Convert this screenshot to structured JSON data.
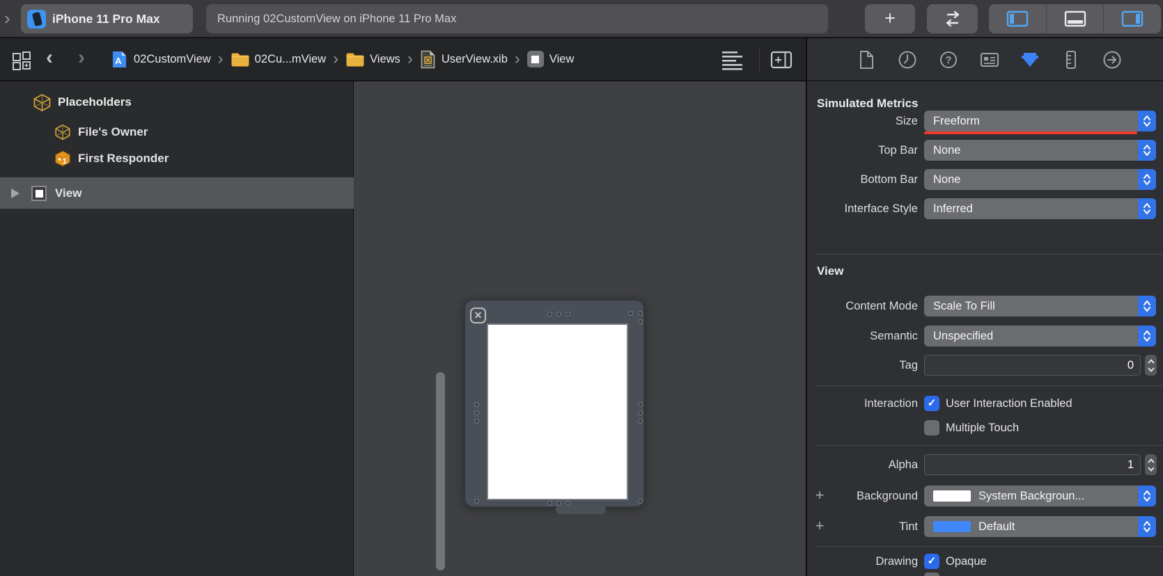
{
  "glyphs": {
    "plus": "+",
    "chevron_left": "‹",
    "chevron_right": "›",
    "breadcrumb_sep": "›",
    "check": "✓",
    "question": "?",
    "arrow_right": "→",
    "letter_a": "A",
    "one": "1",
    "x_close": "✕"
  },
  "toolbar": {
    "device_name": "iPhone 11 Pro Max",
    "status_text": "Running 02CustomView on iPhone 11 Pro Max"
  },
  "jumpbar": {
    "crumbs": [
      {
        "label": "02CustomView",
        "icon": "project-file-icon"
      },
      {
        "label": "02Cu...mView",
        "icon": "folder-icon"
      },
      {
        "label": "Views",
        "icon": "folder-icon"
      },
      {
        "label": "UserView.xib",
        "icon": "xib-file-icon"
      },
      {
        "label": "View",
        "icon": "view-icon"
      }
    ]
  },
  "outline": {
    "placeholders": "Placeholders",
    "files_owner": "File's Owner",
    "first_responder": "First Responder",
    "view": "View"
  },
  "inspector": {
    "simulated_metrics": {
      "title": "Simulated Metrics",
      "size_label": "Size",
      "size_value": "Freeform",
      "top_bar_label": "Top Bar",
      "top_bar_value": "None",
      "bottom_bar_label": "Bottom Bar",
      "bottom_bar_value": "None",
      "interface_style_label": "Interface Style",
      "interface_style_value": "Inferred"
    },
    "view": {
      "title": "View",
      "content_mode_label": "Content Mode",
      "content_mode_value": "Scale To Fill",
      "semantic_label": "Semantic",
      "semantic_value": "Unspecified",
      "tag_label": "Tag",
      "tag_value": "0",
      "interaction_label": "Interaction",
      "user_interaction_enabled": "User Interaction Enabled",
      "multiple_touch": "Multiple Touch",
      "alpha_label": "Alpha",
      "alpha_value": "1",
      "background_label": "Background",
      "background_value": "System Backgroun...",
      "tint_label": "Tint",
      "tint_value": "Default",
      "drawing_label": "Drawing",
      "opaque": "Opaque"
    }
  },
  "colors": {
    "accent_blue": "#3273e8",
    "checkbox_blue": "#2a6aeb",
    "modified_red": "#ed3a2a",
    "folder_yellow": "#e8b13d",
    "cube_orange": "#cfa43b",
    "background_swatch": "#ffffff",
    "tint_swatch": "#3f86f7",
    "panel_bg": "#2f3033",
    "canvas_bg": "#3f4043"
  }
}
